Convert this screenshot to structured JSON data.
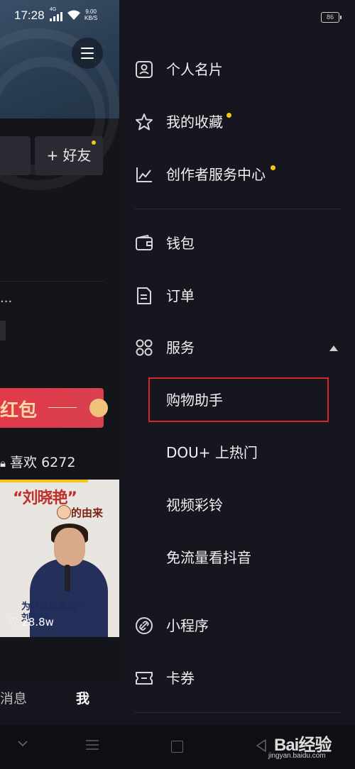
{
  "status_bar": {
    "time": "17:28",
    "network": "4G",
    "speed_value": "9.00",
    "speed_unit": "KB/S",
    "battery": "86"
  },
  "background_app": {
    "add_friend_label": "+ 好友",
    "dots_text": "...",
    "redpacket_text": "红包",
    "likes_text": "喜欢 6272",
    "thumbnail": {
      "title_top": "“刘晓艳”",
      "title_bottom": "的由来",
      "caption_line1": "为什么给我起个",
      "caption_line2": "刘晓艳",
      "views": "28.8w"
    },
    "tabs": {
      "messages": "消息",
      "me": "我"
    }
  },
  "drawer": {
    "items": [
      {
        "label": "个人名片",
        "icon": "profile-card-icon"
      },
      {
        "label": "我的收藏",
        "icon": "star-icon",
        "dot": true
      },
      {
        "label": "创作者服务中心",
        "icon": "chart-icon",
        "dot": true
      },
      {
        "label": "钱包",
        "icon": "wallet-icon"
      },
      {
        "label": "订单",
        "icon": "order-icon"
      },
      {
        "label": "服务",
        "icon": "grid-icon",
        "expanded": true
      },
      {
        "label": "小程序",
        "icon": "link-icon"
      },
      {
        "label": "卡券",
        "icon": "ticket-icon"
      }
    ],
    "service_subitems": [
      {
        "label": "购物助手",
        "highlighted": true
      },
      {
        "label": "DOU+ 上热门"
      },
      {
        "label": "视频彩铃"
      },
      {
        "label": "免流量看抖音"
      }
    ]
  },
  "colors": {
    "dot": "#f5c518",
    "highlight_border": "#d8232a",
    "background": "#16161e"
  },
  "watermark": {
    "logo_text": "Bai经验",
    "url": "jingyan.baidu.com"
  }
}
